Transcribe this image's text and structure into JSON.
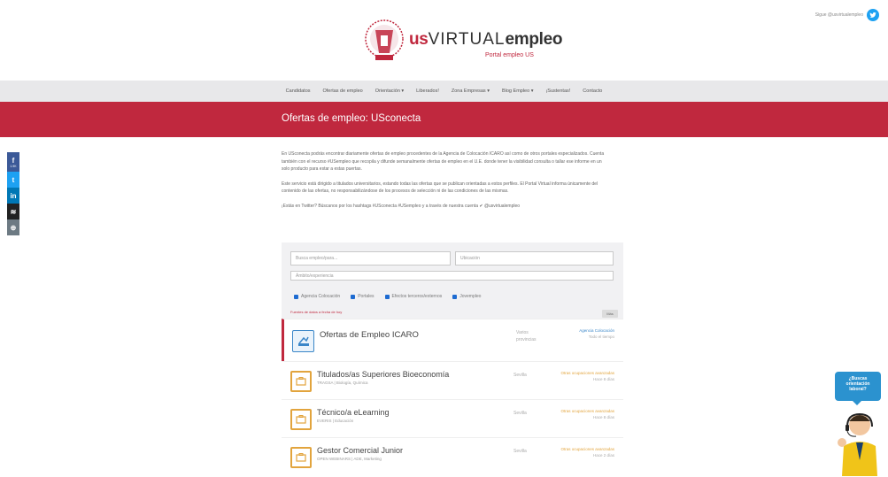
{
  "top_right": {
    "twitter_text": "Sigue @usvirtualempleo"
  },
  "logo": {
    "us": "us",
    "virtual": "VIRTUAL",
    "empleo": "empleo",
    "subtitle": "Portal empleo US"
  },
  "nav": {
    "items": [
      "Candidatos",
      "Ofertas de empleo",
      "Orientación ▾",
      "Liberados!",
      "Zona Empresas ▾",
      "Blog Empleo ▾",
      "¡Sustentas!",
      "Contacto"
    ]
  },
  "banner": {
    "title": "Ofertas de empleo: USconecta"
  },
  "share": {
    "fb_count": "1.9K",
    "fb": "f",
    "tw": "t",
    "li": "in",
    "bf": "≋",
    "ot": "⊕"
  },
  "intro": {
    "p1": "En USconecta podrás encontrar diariamente ofertas de empleo procedentes de la Agencia de Colocación ICARO así como de otros portales especializados. Cuenta también con el recurso #USempleo que recopila y difunde semanalmente ofertas de empleo en el U.E. donde tener la visibilidad consulta o tallar ese informe en un solo producto para estar a estas puertas.",
    "p2": "Este servicio está dirigido a titulados universitarios, estando todas las ofertas que se publican orientadas a estos perfiles. El Portal Virtual informa únicamente del contenido de las ofertas, no responsabilizándose de los procesos de selección ni de las condiciones de las mismas.",
    "p3": "¡Estás en Twitter? Búscanos por los hashtags #USconecta #USempleo y a través de nuestra cuenta ✔ @usvirtualempleo"
  },
  "search": {
    "keyword_placeholder": "Busca empleo/para...",
    "location_placeholder": "Ubicación",
    "third_placeholder": "Ámbito/experiencia",
    "checks": [
      "Agencia Colocación",
      "Portales",
      "Efectos terceros/externos",
      "Jovempleo"
    ],
    "results_text": "Fuentes de datos a fecha de hoy",
    "order_label": "Más"
  },
  "offers": [
    {
      "title": "Ofertas de Empleo ICARO",
      "subtitle": "",
      "mid1": "Varios",
      "mid2": "provincias",
      "src1": "Agencia Colocación",
      "src2": "Todo el tiempo"
    },
    {
      "title": "Titulados/as Superiores Bioeconomía",
      "subtitle": "TRAGSA | Biología, Química",
      "mid1": "Sevilla",
      "mid2": "",
      "src1": "Otras ocupaciones avanzadas",
      "src2": "Hace 8 días"
    },
    {
      "title": "Técnico/a eLearning",
      "subtitle": "EVERIS | Educación",
      "mid1": "Sevilla",
      "mid2": "",
      "src1": "Otras ocupaciones avanzadas",
      "src2": "Hace 8 días"
    },
    {
      "title": "Gestor Comercial Junior",
      "subtitle": "OPEN WEBINARS | ADE, Marketing",
      "mid1": "Sevilla",
      "mid2": "",
      "src1": "Otras ocupaciones avanzadas",
      "src2": "Hace 2 días"
    }
  ],
  "chat": {
    "line1": "¿Buscas",
    "line2": "orientación",
    "line3": "laboral?"
  },
  "colors": {
    "brand_red": "#c0283e",
    "nav_gray": "#e8e8ea",
    "link_blue": "#3a86c8",
    "accent_orange": "#e2a43d"
  }
}
